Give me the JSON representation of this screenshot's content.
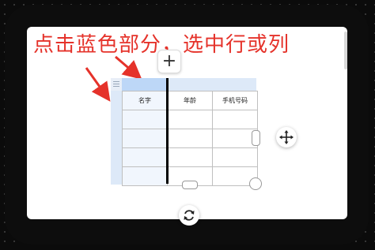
{
  "caption": "点击蓝色部分，选中行或列",
  "table": {
    "headers": [
      "名字",
      "年龄",
      "手机号码"
    ],
    "rows": [
      [
        "",
        "",
        ""
      ],
      [
        "",
        "",
        ""
      ],
      [
        "",
        "",
        ""
      ],
      [
        "",
        "",
        ""
      ]
    ]
  },
  "buttons": {
    "add_symbol": "+"
  },
  "colors": {
    "caption": "#e5322a",
    "selection_handle": "#dde9f8",
    "selected_column": "#bdd7f7"
  },
  "icons": {
    "add": "plus-icon",
    "move": "move-arrows-icon",
    "rotate": "rotate-icon",
    "annotation_arrows": "red-arrow-icon"
  }
}
